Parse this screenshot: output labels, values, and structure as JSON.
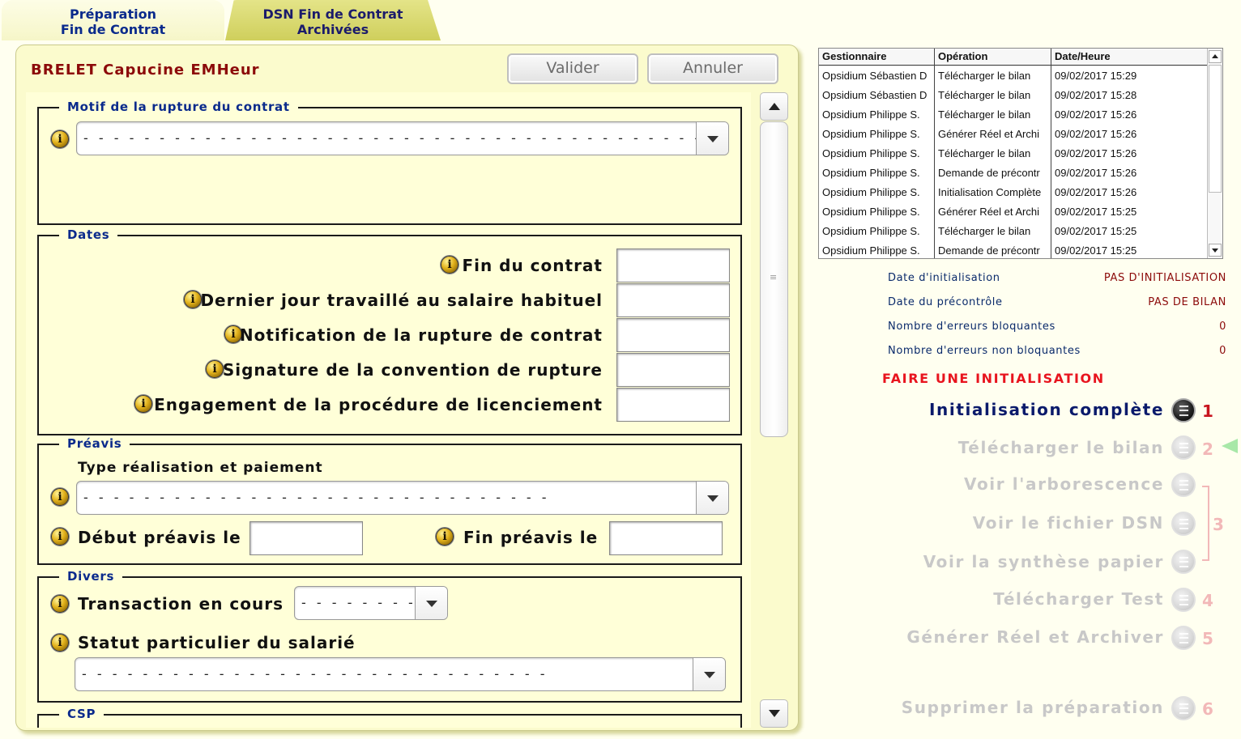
{
  "tabs": [
    {
      "line1": "Préparation",
      "line2": "Fin de Contrat"
    },
    {
      "line1": "DSN Fin de Contrat",
      "line2": "Archivées"
    }
  ],
  "employee": {
    "name": "BRELET  Capucine EMHeur"
  },
  "toolbar": {
    "validate": "Valider",
    "cancel": "Annuler"
  },
  "motif": {
    "title": "Motif de la rupture du contrat",
    "value": "- - - - - - - - - - - - - - - - - - - - - - - - - - - - - - - - - - - - - - - - - - - - - - - - -"
  },
  "dates": {
    "title": "Dates",
    "fields": [
      {
        "label": "Fin du contrat",
        "value": ""
      },
      {
        "label": "Dernier jour travaillé au salaire habituel",
        "value": ""
      },
      {
        "label": "Notification de la rupture de contrat",
        "value": ""
      },
      {
        "label": "Signature de la convention de rupture",
        "value": ""
      },
      {
        "label": "Engagement de la procédure de licenciement",
        "value": ""
      }
    ]
  },
  "preavis": {
    "title": "Préavis",
    "type_label": "Type réalisation et paiement",
    "type_value": "- - - - - - - - - - - - - - - - - - - - - - - - - - - - - - -",
    "debut_label": "Début préavis le",
    "debut_value": "",
    "fin_label": "Fin préavis le",
    "fin_value": ""
  },
  "divers": {
    "title": "Divers",
    "transaction_label": "Transaction en cours",
    "transaction_value": "- - - - - - - - -",
    "statut_label": "Statut particulier du salarié",
    "statut_value": "- - - - - - - - - - - - - - - - - - - - - - - - - - - - - - -"
  },
  "csp": {
    "title": "CSP"
  },
  "history": {
    "columns": [
      "Gestionnaire",
      "Opération",
      "Date/Heure"
    ],
    "rows": [
      [
        "Opsidium Sébastien D",
        "Télécharger le bilan",
        "09/02/2017 15:29"
      ],
      [
        "Opsidium Sébastien D",
        "Télécharger le bilan",
        "09/02/2017 15:28"
      ],
      [
        "Opsidium Philippe S.",
        "Télécharger le bilan",
        "09/02/2017 15:26"
      ],
      [
        "Opsidium Philippe S.",
        "Générer Réel et Archi",
        "09/02/2017 15:26"
      ],
      [
        "Opsidium Philippe S.",
        "Télécharger le bilan",
        "09/02/2017 15:26"
      ],
      [
        "Opsidium Philippe S.",
        "Demande de précontr",
        "09/02/2017 15:26"
      ],
      [
        "Opsidium Philippe S.",
        "Initialisation Complète",
        "09/02/2017 15:26"
      ],
      [
        "Opsidium Philippe S.",
        "Générer Réel et Archi",
        "09/02/2017 15:25"
      ],
      [
        "Opsidium Philippe S.",
        "Télécharger le bilan",
        "09/02/2017 15:25"
      ],
      [
        "Opsidium Philippe S.",
        "Demande de précontr",
        "09/02/2017 15:25"
      ]
    ]
  },
  "status": [
    {
      "label": "Date d'initialisation",
      "value": "PAS D'INITIALISATION"
    },
    {
      "label": "Date du précontrôle",
      "value": "PAS DE BILAN"
    },
    {
      "label": "Nombre d'erreurs bloquantes",
      "value": "0"
    },
    {
      "label": "Nombre d'erreurs non bloquantes",
      "value": "0"
    }
  ],
  "alert": "FAIRE UNE INITIALISATION",
  "actions": [
    {
      "label": "Initialisation complète",
      "num": "1",
      "enabled": true
    },
    {
      "label": "Télécharger le bilan",
      "num": "2",
      "enabled": false
    },
    {
      "label": "Voir l'arborescence",
      "num": "",
      "enabled": false
    },
    {
      "label": "Voir le fichier DSN",
      "num": "3",
      "enabled": false
    },
    {
      "label": "Voir la synthèse papier",
      "num": "",
      "enabled": false
    },
    {
      "label": "Télécharger Test",
      "num": "4",
      "enabled": false
    },
    {
      "label": "Générer Réel et Archiver",
      "num": "5",
      "enabled": false
    },
    {
      "label": "Supprimer la préparation",
      "num": "6",
      "enabled": false
    }
  ],
  "colors": {
    "accent_blue": "#0a2a8c",
    "alert_red": "#e8141e",
    "panel_bg": "#fbfbcd",
    "tab_inactive": "#cfcf5c"
  }
}
